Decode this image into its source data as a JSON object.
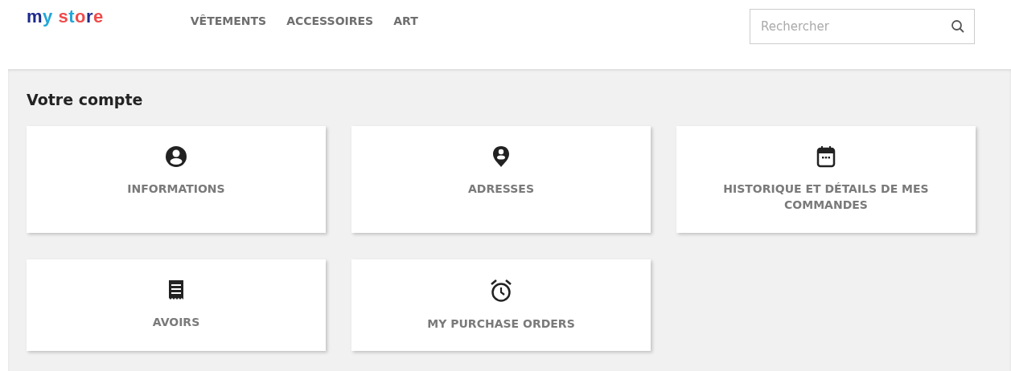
{
  "header": {
    "logo": "my store",
    "nav": [
      {
        "label": "VÊTEMENTS"
      },
      {
        "label": "ACCESSOIRES"
      },
      {
        "label": "ART"
      }
    ],
    "search": {
      "placeholder": "Rechercher"
    }
  },
  "page": {
    "title": "Votre compte",
    "links": [
      {
        "label": "INFORMATIONS",
        "kind": "user"
      },
      {
        "label": "ADRESSES",
        "kind": "pin"
      },
      {
        "label": "HISTORIQUE ET DÉTAILS DE MES COMMANDES",
        "kind": "calendar"
      },
      {
        "label": "AVOIRS",
        "kind": "receipt"
      },
      {
        "label": "MY PURCHASE ORDERS",
        "kind": "alarm"
      }
    ]
  }
}
